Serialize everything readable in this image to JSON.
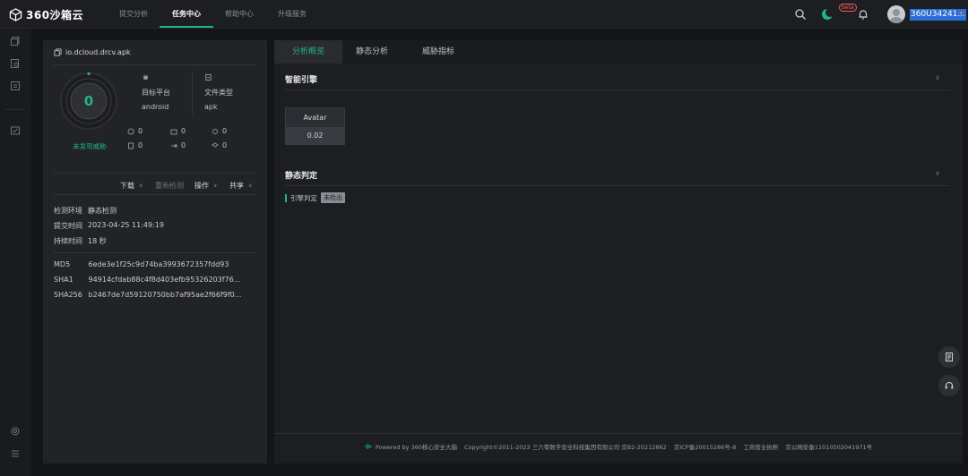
{
  "brand": {
    "logo_text": "360沙箱云"
  },
  "nav": {
    "items": [
      {
        "label": "提交分析"
      },
      {
        "label": "任务中心"
      },
      {
        "label": "帮助中心"
      },
      {
        "label": "升级服务"
      }
    ],
    "active": "任务中心"
  },
  "topbar": {
    "beta_label": "beta",
    "username": "360U34241..."
  },
  "file": {
    "name": "io.dcloud.drcv.apk",
    "score": "0",
    "threat_status": "未发现威胁",
    "platform_label": "目标平台",
    "platform_value": "android",
    "filetype_label": "文件类型",
    "filetype_value": "apk",
    "stats": [
      "0",
      "0",
      "0",
      "0",
      "0",
      "0"
    ]
  },
  "actions": {
    "download": "下载",
    "recheck": "重新检测",
    "operate": "操作",
    "share": "共享"
  },
  "info": {
    "env_label": "检测环境",
    "env_value": "静态检测",
    "submit_label": "提交时间",
    "submit_value": "2023-04-25 11:49:19",
    "duration_label": "持续时间",
    "duration_value": "18 秒"
  },
  "hashes": {
    "md5_label": "MD5",
    "md5_value": "6ede3e1f25c9d74ba3993672357fdd93",
    "sha1_label": "SHA1",
    "sha1_value": "94914cfdab88c4f8d403efb95326203f76...",
    "sha256_label": "SHA256",
    "sha256_value": "b2467de7d59120750bb7af95ae2f66f9f0..."
  },
  "tabs": [
    {
      "label": "分析概览"
    },
    {
      "label": "静态分析"
    },
    {
      "label": "威胁指标"
    }
  ],
  "sections": {
    "engine_title": "智能引擎",
    "engine_name": "Avatar",
    "engine_score": "0.02",
    "static_title": "静态判定",
    "verdict_label": "引擎判定",
    "verdict_value": "未检出"
  },
  "footer": {
    "powered": "Powered by 360核心安全大脑",
    "copyright": "Copyright©2011-2023 三六零数字安全科技集团有限公司 京B2-20212862",
    "icp": "京ICP备20015286号-8",
    "license": "工商营业执照",
    "police": "京公网安备11010502041971号"
  },
  "colors": {
    "accent": "#1fb580",
    "background": "#141518",
    "panel": "#222327"
  },
  "icons": [
    "search-icon",
    "moon-icon",
    "bell-icon",
    "doc-icon",
    "headset-icon"
  ]
}
